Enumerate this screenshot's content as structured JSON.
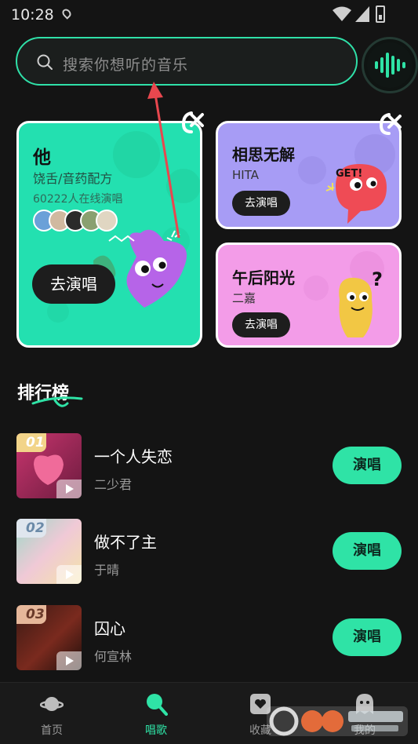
{
  "status_bar": {
    "time": "10:28"
  },
  "search": {
    "placeholder": "搜索你想听的音乐"
  },
  "featured": {
    "main": {
      "title": "他",
      "subtitle": "饶舌/音药配方",
      "online": "60222人在线演唱",
      "button": "去演唱"
    },
    "card_a": {
      "title": "相思无解",
      "subtitle": "HITA",
      "button": "去演唱"
    },
    "card_b": {
      "title": "午后阳光",
      "subtitle": "二嘉",
      "button": "去演唱"
    }
  },
  "ranking": {
    "title": "排行榜",
    "items": [
      {
        "rank": "01",
        "song": "一个人失恋",
        "artist": "二少君",
        "button": "演唱"
      },
      {
        "rank": "02",
        "song": "做不了主",
        "artist": "于晴",
        "button": "演唱"
      },
      {
        "rank": "03",
        "song": "囚心",
        "artist": "何宣林",
        "button": "演唱"
      }
    ]
  },
  "nav": {
    "items": [
      {
        "label": "首页",
        "icon": "planet-icon"
      },
      {
        "label": "唱歌",
        "icon": "microphone-icon"
      },
      {
        "label": "收藏",
        "icon": "heart-box-icon"
      },
      {
        "label": "我的",
        "icon": "ghost-icon"
      }
    ],
    "active": "唱歌"
  },
  "colors": {
    "accent": "#2fe3a6",
    "card_main": "#23e0b0",
    "card_a": "#a79cf5",
    "card_b": "#f39ce8",
    "background": "#141414"
  }
}
